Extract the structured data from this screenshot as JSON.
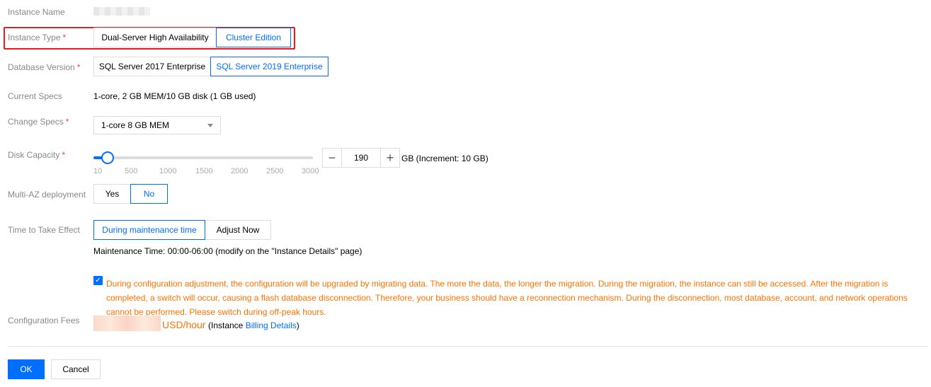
{
  "form": {
    "instance_name": {
      "label": "Instance Name"
    },
    "instance_type": {
      "label": "Instance Type",
      "required": "*",
      "options": [
        "Dual-Server High Availability",
        "Cluster Edition"
      ],
      "selected": 1
    },
    "database_version": {
      "label": "Database Version",
      "required": "*",
      "options": [
        "SQL Server 2017 Enterprise",
        "SQL Server 2019 Enterprise"
      ],
      "selected": 1
    },
    "current_specs": {
      "label": "Current Specs",
      "value": "1-core, 2 GB MEM/10 GB disk (1 GB used)"
    },
    "change_specs": {
      "label": "Change Specs",
      "required": "*",
      "value": "1-core 8 GB MEM",
      "icon": "chevron-down-icon"
    },
    "disk_capacity": {
      "label": "Disk Capacity",
      "required": "*",
      "slider_min": 10,
      "slider_max": 3000,
      "ticks": [
        "10",
        "500",
        "1000",
        "1500",
        "2000",
        "2500",
        "3000"
      ],
      "value": "190",
      "decrement": "−",
      "increment": "+",
      "unit_note": "GB (Increment: 10 GB)"
    },
    "multi_az": {
      "label": "Multi-AZ deployment",
      "options": [
        "Yes",
        "No"
      ],
      "selected": 1
    },
    "time_to_effect": {
      "label": "Time to Take Effect",
      "options": [
        "During maintenance time",
        "Adjust Now"
      ],
      "selected": 0,
      "maintenance_note": "Maintenance Time: 00:00-06:00 (modify on the \"Instance Details\" page)"
    },
    "warning": {
      "checked": true,
      "text": "During configuration adjustment, the configuration will be upgraded by migrating data. The more the data, the longer the migration. During the migration, the instance can still be accessed. After the migration is completed, a switch will occur, causing a flash database disconnection. Therefore, your business should have a reconnection mechanism. During the disconnection, most database, account, and network operations cannot be performed. Please switch during off-peak hours."
    },
    "fees": {
      "label": "Configuration Fees",
      "unit": "USD/hour",
      "note_prefix": "(Instance ",
      "note_link": "Billing Details",
      "note_suffix": ")"
    }
  },
  "actions": {
    "ok": "OK",
    "cancel": "Cancel"
  },
  "colors": {
    "accent": "#006eff",
    "warning": "#ff7200",
    "required": "#e54545",
    "highlight": "#e02020"
  }
}
